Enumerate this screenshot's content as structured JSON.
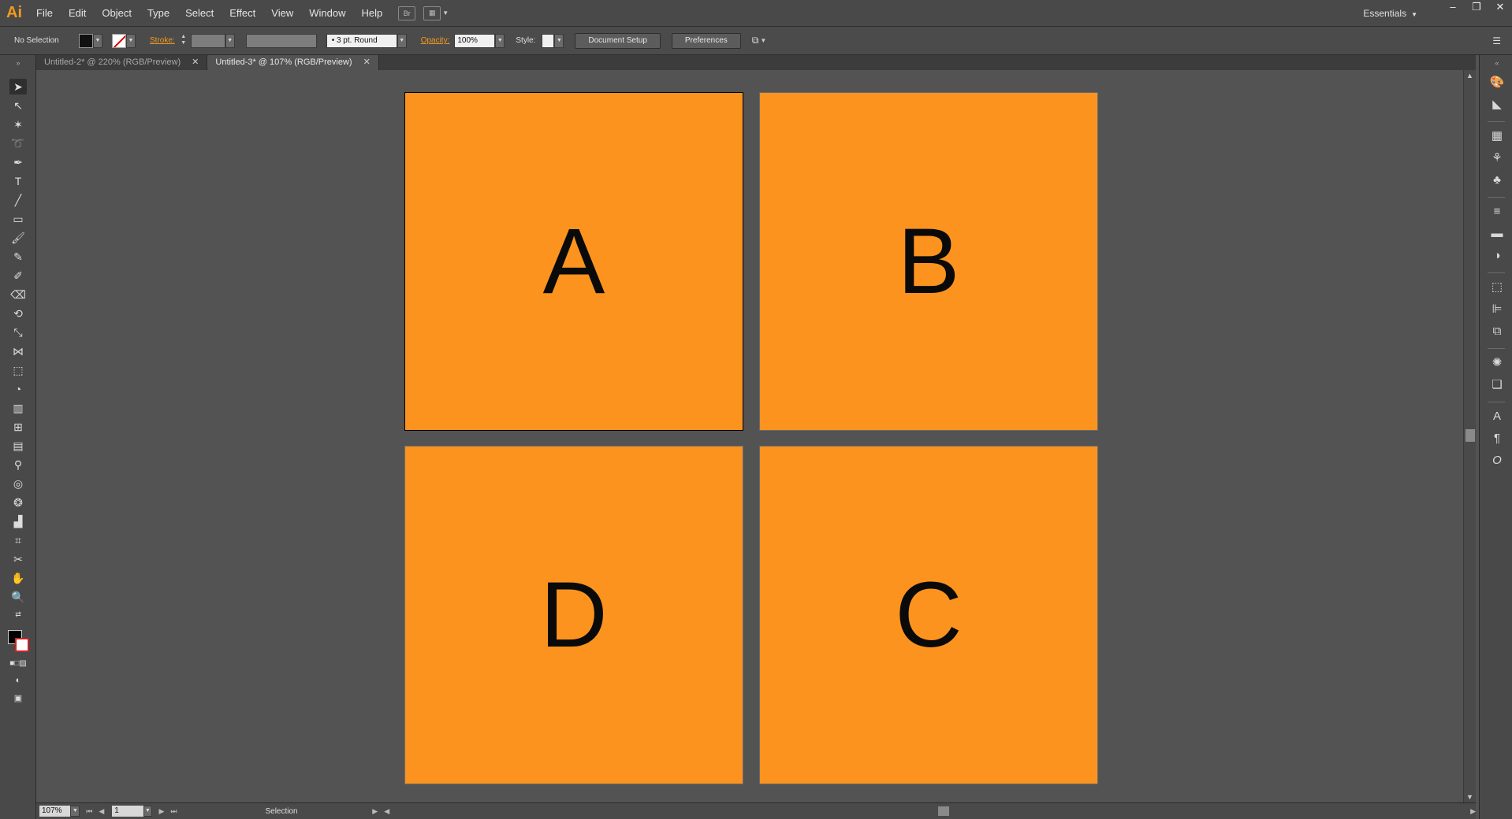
{
  "app": {
    "logo": "Ai",
    "workspace": "Essentials"
  },
  "menu": [
    "File",
    "Edit",
    "Object",
    "Type",
    "Select",
    "Effect",
    "View",
    "Window",
    "Help"
  ],
  "window_controls": [
    "–",
    "❐",
    "✕"
  ],
  "control_bar": {
    "selection": "No Selection",
    "stroke_label": "Stroke:",
    "brush": "3 pt. Round",
    "opacity_label": "Opacity:",
    "opacity_value": "100%",
    "style_label": "Style:",
    "document_setup": "Document Setup",
    "preferences": "Preferences"
  },
  "tabs": [
    {
      "label": "Untitled-2* @ 220% (RGB/Preview)",
      "active": false
    },
    {
      "label": "Untitled-3* @ 107% (RGB/Preview)",
      "active": true
    }
  ],
  "artboards": [
    {
      "letter": "A"
    },
    {
      "letter": "B"
    },
    {
      "letter": "D"
    },
    {
      "letter": "C"
    }
  ],
  "colors": {
    "artboard_fill": "#fc931e",
    "accent": "#f29a1f",
    "canvas": "#535353"
  },
  "status": {
    "zoom": "107%",
    "page": "1",
    "tool": "Selection"
  }
}
